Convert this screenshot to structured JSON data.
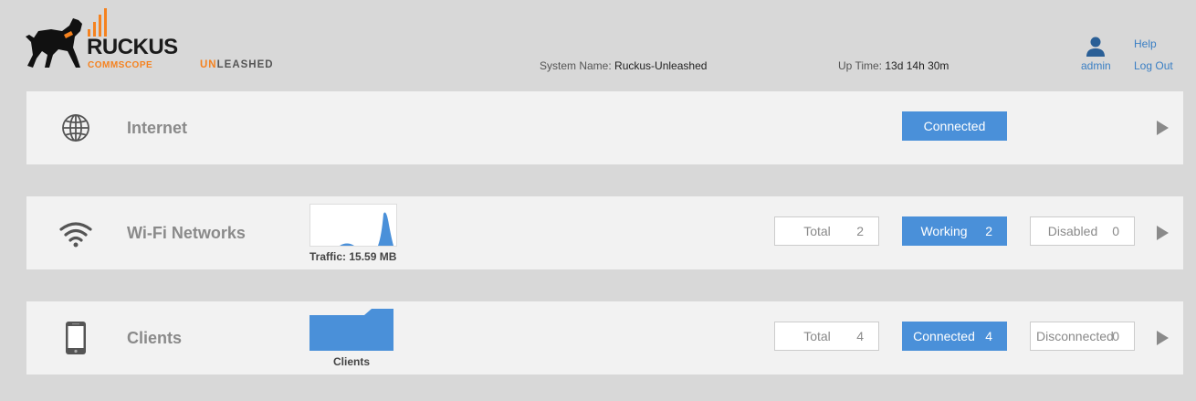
{
  "header": {
    "brand_name": "RUCKUS",
    "brand_sub": "COMMSCOPE",
    "product_prefix": "UN",
    "product_rest": "LEASHED",
    "system_name_label": "System Name:",
    "system_name_value": "Ruckus-Unleashed",
    "uptime_label": "Up Time:",
    "uptime_value": "13d 14h 30m",
    "user": "admin",
    "help": "Help",
    "logout": "Log Out"
  },
  "internet": {
    "title": "Internet",
    "status": "Connected",
    "icon": "globe-icon"
  },
  "wifi": {
    "title": "Wi-Fi Networks",
    "icon": "wifi-icon",
    "caption": "Traffic: 15.59 MB",
    "total_label": "Total",
    "total_value": "2",
    "working_label": "Working",
    "working_value": "2",
    "disabled_label": "Disabled",
    "disabled_value": "0"
  },
  "clients": {
    "title": "Clients",
    "icon": "phone-icon",
    "caption": "Clients",
    "total_label": "Total",
    "total_value": "4",
    "connected_label": "Connected",
    "connected_value": "4",
    "disconnected_label": "Disconnected",
    "disconnected_value": "0"
  },
  "colors": {
    "accent": "#4a90d9",
    "brand_orange": "#f5821f",
    "link": "#3a7fc4"
  }
}
